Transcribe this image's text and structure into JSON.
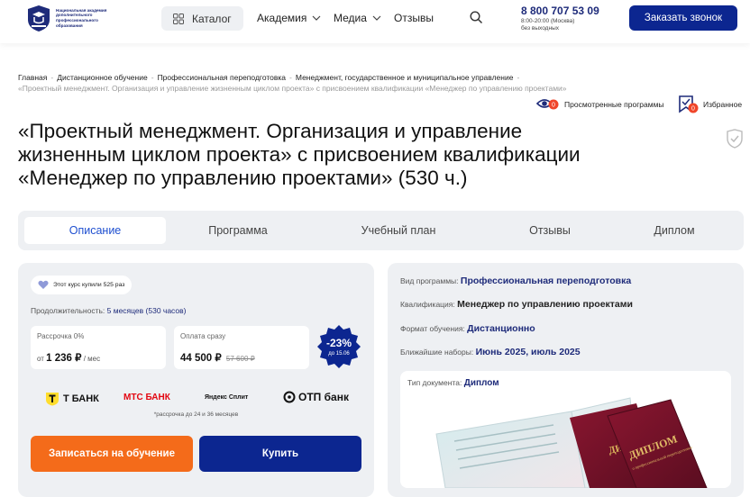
{
  "header": {
    "logo_text": "Национальная академия дополнительного профессионального образования",
    "catalog_label": "Каталог",
    "nav": [
      {
        "label": "Академия"
      },
      {
        "label": "Медиа"
      },
      {
        "label": "Отзывы"
      }
    ],
    "phone": "8 800 707 53 09",
    "hours_line1": "8:00-20:00 (Москва)",
    "hours_line2": "без выходных",
    "call_button": "Заказать звонок"
  },
  "breadcrumbs": {
    "items": [
      "Главная",
      "Дистанционное обучение",
      "Профессиональная переподготовка",
      "Менеджмент, государственное и муниципальное управление"
    ],
    "current": "«Проектный менеджмент. Организация и управление жизненным циклом проекта» с присвоением квалификации «Менеджер по управлению проектами»"
  },
  "actions": {
    "viewed": "Просмотренные программы",
    "viewed_count": "0",
    "favorites": "Избранное",
    "favorites_count": "0"
  },
  "title": "«Проектный менеджмент. Организация и управление жизненным циклом проекта» с присвоением квалификации «Менеджер по управлению проектами» (530 ч.)",
  "tabs": [
    {
      "label": "Описание"
    },
    {
      "label": "Программа"
    },
    {
      "label": "Учебный план"
    },
    {
      "label": "Отзывы"
    },
    {
      "label": "Диплом"
    }
  ],
  "purchase": {
    "badge": "Этот курс купили 525 раз",
    "duration_label": "Продолжительность:",
    "duration_value": "5 месяцев (530 часов)",
    "installment_label": "Рассрочка 0%",
    "installment_prefix": "от",
    "installment_price": "1 236 ₽",
    "installment_suffix": "/ мес",
    "full_label": "Оплата сразу",
    "full_price": "44 500 ₽",
    "old_price": "57 600 ₽",
    "discount": "-23%",
    "discount_until": "до 15.06",
    "banks": [
      "Т БАНК",
      "МТС БАНК",
      "Яндекс Сплит",
      "ОТП банк"
    ],
    "banks_note": "*рассрочка до 24 и 36 месяцев",
    "enroll_button": "Записаться на обучение",
    "buy_button": "Купить"
  },
  "program_info": {
    "type_label": "Вид программы:",
    "type_value": "Профессиональная переподготовка",
    "qual_label": "Квалификация:",
    "qual_value": "Менеджер по управлению проектами",
    "format_label": "Формат обучения:",
    "format_value": "Дистанционно",
    "intake_label": "Ближайшие наборы:",
    "intake_value": "Июнь 2025, июль 2025",
    "doc_label": "Тип документа:",
    "doc_value": "Диплом",
    "diploma_text": "ДИПЛОМ",
    "diploma_sub": "о профессиональной переподготовке"
  },
  "colors": {
    "brand_navy": "#0c2690",
    "accent_orange": "#f46b1a",
    "link_blue": "#1e4fd0",
    "panel_gray": "#eef0f3"
  }
}
